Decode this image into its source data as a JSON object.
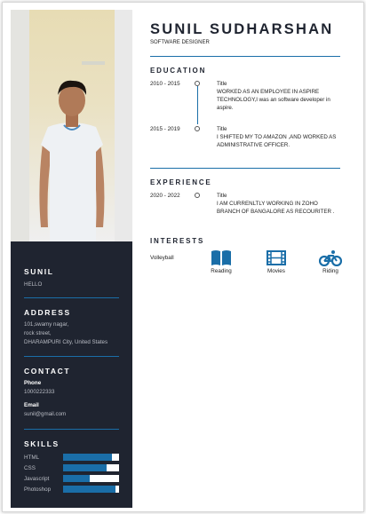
{
  "profile": {
    "name": "SUNIL SUDHARSHAN",
    "role": "SOFTWARE DESIGNER",
    "side_name": "SUNIL",
    "side_greeting": "HELLO"
  },
  "address": {
    "heading": "ADDRESS",
    "line1": "101,swamy nagar,",
    "line2": "rock street,",
    "line3": "DHARAMPURI City, United States"
  },
  "contact": {
    "heading": "CONTACT",
    "phone_label": "Phone",
    "phone_value": "1000222333",
    "email_label": "Email",
    "email_value": "sunil@gmail.com"
  },
  "skills": {
    "heading": "SKILLS",
    "items": [
      {
        "name": "HTML",
        "level": 0.88
      },
      {
        "name": "CSS",
        "level": 0.78
      },
      {
        "name": "Javascript",
        "level": 0.48
      },
      {
        "name": "Photoshop",
        "level": 0.94
      }
    ]
  },
  "education": {
    "heading": "EDUCATION",
    "items": [
      {
        "date": "2010 - 2015",
        "title": "Title",
        "desc": "WORKED AS AN EMPLOYEE IN ASPIRE TECHNOLOGY,I was an software developer in aspire."
      },
      {
        "date": "2015 - 2019",
        "title": "Title",
        "desc": "I SHIFTED MY TO AMAZON ,AND WORKED AS ADMINISTRATIVE OFFICER."
      }
    ]
  },
  "experience": {
    "heading": "EXPERIENCE",
    "items": [
      {
        "date": "2020 - 2022",
        "title": "Title",
        "desc": "I AM CURRENLTLY WORKING IN ZOHO BRANCH OF BANGALORE AS RECOURITER ."
      }
    ]
  },
  "interests": {
    "heading": "INTERESTS",
    "label": "Volleyball",
    "items": [
      {
        "name": "Reading",
        "icon": "book-icon"
      },
      {
        "name": "Movies",
        "icon": "film-icon"
      },
      {
        "name": "Riding",
        "icon": "bicycle-icon"
      }
    ]
  },
  "colors": {
    "accent": "#1a6ea8",
    "sidebar": "#1f2430"
  }
}
